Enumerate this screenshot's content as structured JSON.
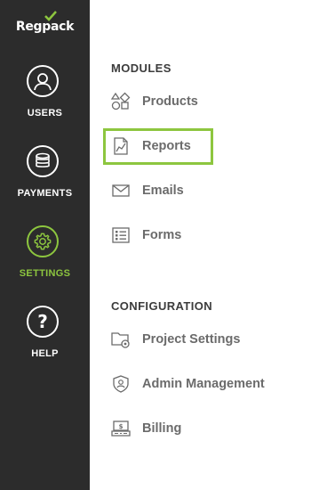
{
  "brand": {
    "name": "Regpack",
    "accent": "#8dc63f"
  },
  "sidebar": {
    "items": [
      {
        "label": "USERS",
        "icon": "user-icon",
        "active": false
      },
      {
        "label": "PAYMENTS",
        "icon": "coins-icon",
        "active": false
      },
      {
        "label": "SETTINGS",
        "icon": "gear-icon",
        "active": true
      },
      {
        "label": "HELP",
        "icon": "question-icon",
        "active": false
      }
    ]
  },
  "modules": {
    "title": "MODULES",
    "items": [
      {
        "label": "Products",
        "icon": "shapes-icon"
      },
      {
        "label": "Reports",
        "icon": "report-chart-icon",
        "selected": true
      },
      {
        "label": "Emails",
        "icon": "envelope-icon"
      },
      {
        "label": "Forms",
        "icon": "form-list-icon"
      }
    ]
  },
  "configuration": {
    "title": "CONFIGURATION",
    "items": [
      {
        "label": "Project Settings",
        "icon": "folder-gear-icon"
      },
      {
        "label": "Admin Management",
        "icon": "shield-user-icon"
      },
      {
        "label": "Billing",
        "icon": "billing-icon"
      }
    ]
  }
}
